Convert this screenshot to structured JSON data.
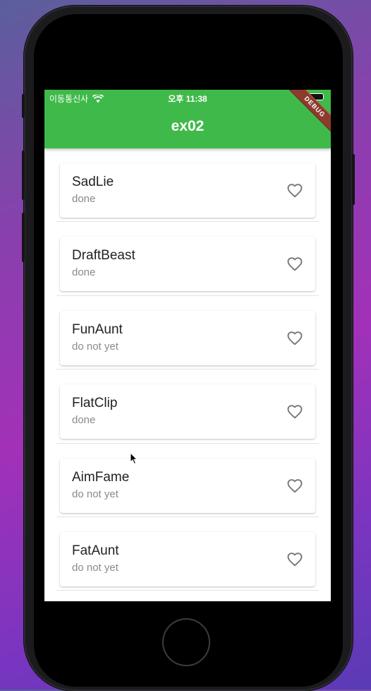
{
  "status_bar": {
    "carrier": "이동통신사",
    "time": "오후 11:38"
  },
  "app_bar": {
    "title": "ex02",
    "debug_banner": "DEBUG"
  },
  "items": [
    {
      "title": "SadLie",
      "status": "done",
      "icon": "heart-outline-icon"
    },
    {
      "title": "DraftBeast",
      "status": "done",
      "icon": "heart-outline-icon"
    },
    {
      "title": "FunAunt",
      "status": "do not yet",
      "icon": "heart-outline-icon"
    },
    {
      "title": "FlatClip",
      "status": "done",
      "icon": "heart-outline-icon"
    },
    {
      "title": "AimFame",
      "status": "do not yet",
      "icon": "heart-outline-icon"
    },
    {
      "title": "FatAunt",
      "status": "do not yet",
      "icon": "heart-outline-icon"
    }
  ],
  "colors": {
    "app_bar": "#3fba4a",
    "debug_banner": "#8e3a2d"
  }
}
